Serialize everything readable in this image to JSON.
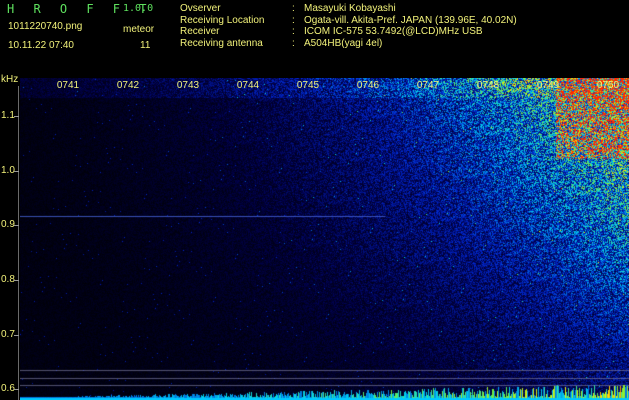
{
  "header": {
    "app_title": "H R O F F T",
    "app_version": "1.0.0",
    "filename": "1011220740.png",
    "mode_label": "meteor",
    "datetime": "10.11.22 07:40",
    "count": "11",
    "info": [
      {
        "key": "Ovserver",
        "value": "Masayuki Kobayashi"
      },
      {
        "key": "Receiving Location",
        "value": "Ogata-vill. Akita-Pref. JAPAN (139.96E, 40.02N)"
      },
      {
        "key": "Receiver",
        "value": "ICOM IC-575 53.7492(@LCD)MHz USB"
      },
      {
        "key": "Receiving antenna",
        "value": "A504HB(yagi 4el)"
      }
    ]
  },
  "chart_data": {
    "type": "heatmap",
    "ylabel": "kHz",
    "yticks": [
      "1.1",
      "1.0",
      "0.9",
      "0.8",
      "0.7",
      "0.6"
    ],
    "ytick_values": [
      1.1,
      1.0,
      0.9,
      0.8,
      0.7,
      0.6
    ],
    "xticks": [
      "0741",
      "0742",
      "0743",
      "0744",
      "0745",
      "0746",
      "0747",
      "0748",
      "0749",
      "0750"
    ],
    "ylim": [
      0.58,
      1.17
    ],
    "colors": {
      "text": "#f2f27a",
      "title": "#5ee05e"
    }
  }
}
